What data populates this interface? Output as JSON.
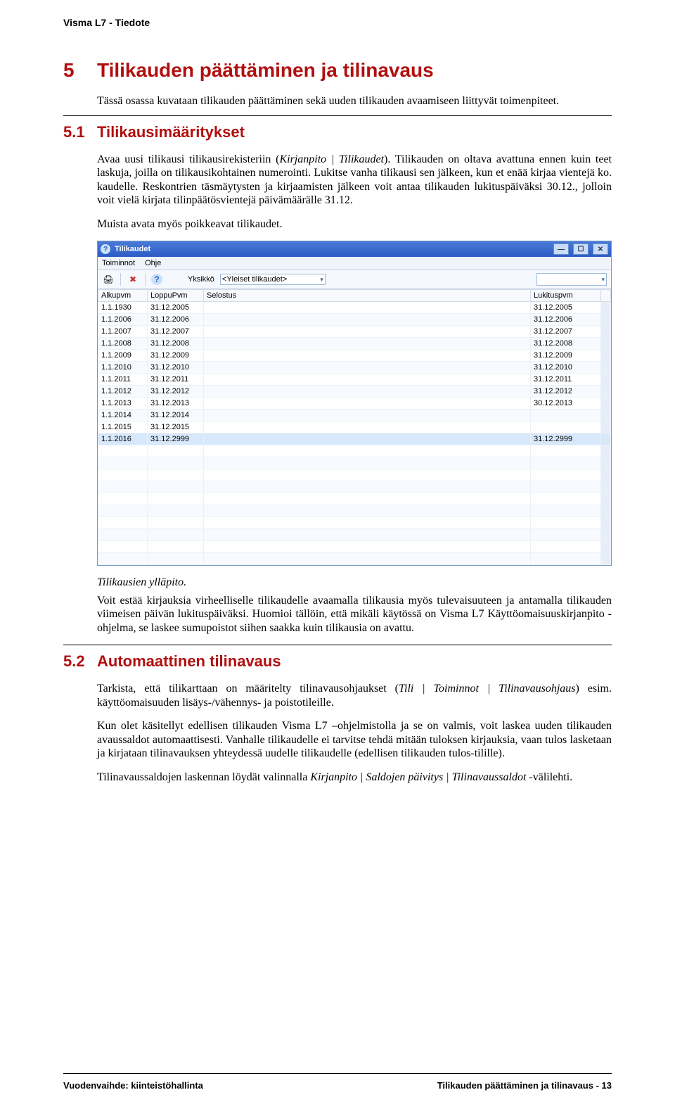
{
  "header": {
    "top": "Visma L7 - Tiedote"
  },
  "section5": {
    "num": "5",
    "title": "Tilikauden päättäminen ja tilinavaus",
    "intro": "Tässä osassa kuvataan tilikauden päättäminen sekä uuden tilikauden avaamiseen liittyvät toimenpiteet."
  },
  "section51": {
    "num": "5.1",
    "title": "Tilikausimääritykset",
    "p1a": "Avaa uusi tilikausi tilikausirekisteriin (",
    "p1b": "Kirjanpito | Tilikaudet",
    "p1c": "). Tilikauden on oltava avattuna ennen kuin teet laskuja, joilla on tilikausikohtainen numerointi. Lukitse vanha tilikausi sen jälkeen, kun et enää kirjaa vientejä ko. kaudelle. Reskontrien täsmäytysten ja kirjaamisten jälkeen voit antaa tilikauden lukituspäiväksi 30.12., jolloin voit vielä kirjata tilinpäätösvientejä päivämäärälle 31.12.",
    "p2": "Muista avata myös poikkeavat tilikaudet.",
    "caption": "Tilikausien ylläpito.",
    "p3": "Voit estää kirjauksia virheelliselle tilikaudelle avaamalla tilikausia myös tulevaisuuteen ja antamalla tilikauden viimeisen päivän lukituspäiväksi. Huomioi tällöin, että mikäli käytössä on Visma L7 Käyttöomaisuuskirjanpito -ohjelma, se laskee sumupoistot siihen saakka kuin tilikausia on avattu."
  },
  "section52": {
    "num": "5.2",
    "title": "Automaattinen tilinavaus",
    "p1a": "Tarkista, että tilikarttaan on määritelty tilinavausohjaukset (",
    "p1b": "Tili | Toiminnot | Tilinavausohjaus",
    "p1c": ") esim. käyttöomaisuuden lisäys-/vähennys- ja poistotileille.",
    "p2": "Kun olet käsitellyt edellisen tilikauden Visma L7 –ohjelmistolla ja se on valmis, voit laskea uuden tilikauden avaussaldot automaattisesti. Vanhalle tilikaudelle ei tarvitse tehdä mitään tuloksen kirjauksia, vaan tulos lasketaan ja kirjataan tilinavauksen yhteydessä uudelle tilikaudelle (edellisen tilikauden tulos-tilille).",
    "p3a": "Tilinavaussaldojen laskennan löydät valinnalla ",
    "p3b": "Kirjanpito | Saldojen päivitys | Tilinavaussaldot",
    "p3c": " -välilehti."
  },
  "window": {
    "title": "Tilikaudet",
    "menu": {
      "toiminnot": "Toiminnot",
      "ohje": "Ohje"
    },
    "toolbar": {
      "print": "🖨",
      "delete": "✖",
      "help": "?",
      "unit_label": "Yksikkö",
      "unit_value": "<Yleiset tilikaudet>"
    },
    "columns": {
      "c1": "Alkupvm",
      "c2": "LoppuPvm",
      "c3": "Selostus",
      "c4": "Lukituspvm"
    },
    "rows": [
      {
        "a": "1.1.1930",
        "b": "31.12.2005",
        "c": "",
        "d": "31.12.2005"
      },
      {
        "a": "1.1.2006",
        "b": "31.12.2006",
        "c": "",
        "d": "31.12.2006"
      },
      {
        "a": "1.1.2007",
        "b": "31.12.2007",
        "c": "",
        "d": "31.12.2007"
      },
      {
        "a": "1.1.2008",
        "b": "31.12.2008",
        "c": "",
        "d": "31.12.2008"
      },
      {
        "a": "1.1.2009",
        "b": "31.12.2009",
        "c": "",
        "d": "31.12.2009"
      },
      {
        "a": "1.1.2010",
        "b": "31.12.2010",
        "c": "",
        "d": "31.12.2010"
      },
      {
        "a": "1.1.2011",
        "b": "31.12.2011",
        "c": "",
        "d": "31.12.2011"
      },
      {
        "a": "1.1.2012",
        "b": "31.12.2012",
        "c": "",
        "d": "31.12.2012"
      },
      {
        "a": "1.1.2013",
        "b": "31.12.2013",
        "c": "",
        "d": "30.12.2013"
      },
      {
        "a": "1.1.2014",
        "b": "31.12.2014",
        "c": "",
        "d": ""
      },
      {
        "a": "1.1.2015",
        "b": "31.12.2015",
        "c": "",
        "d": ""
      },
      {
        "a": "1.1.2016",
        "b": "31.12.2999",
        "c": "",
        "d": "31.12.2999",
        "selected": true
      }
    ],
    "blank_rows": 10
  },
  "footer": {
    "left": "Vuodenvaihde: kiinteistöhallinta",
    "right": "Tilikauden päättäminen ja tilinavaus - 13"
  }
}
